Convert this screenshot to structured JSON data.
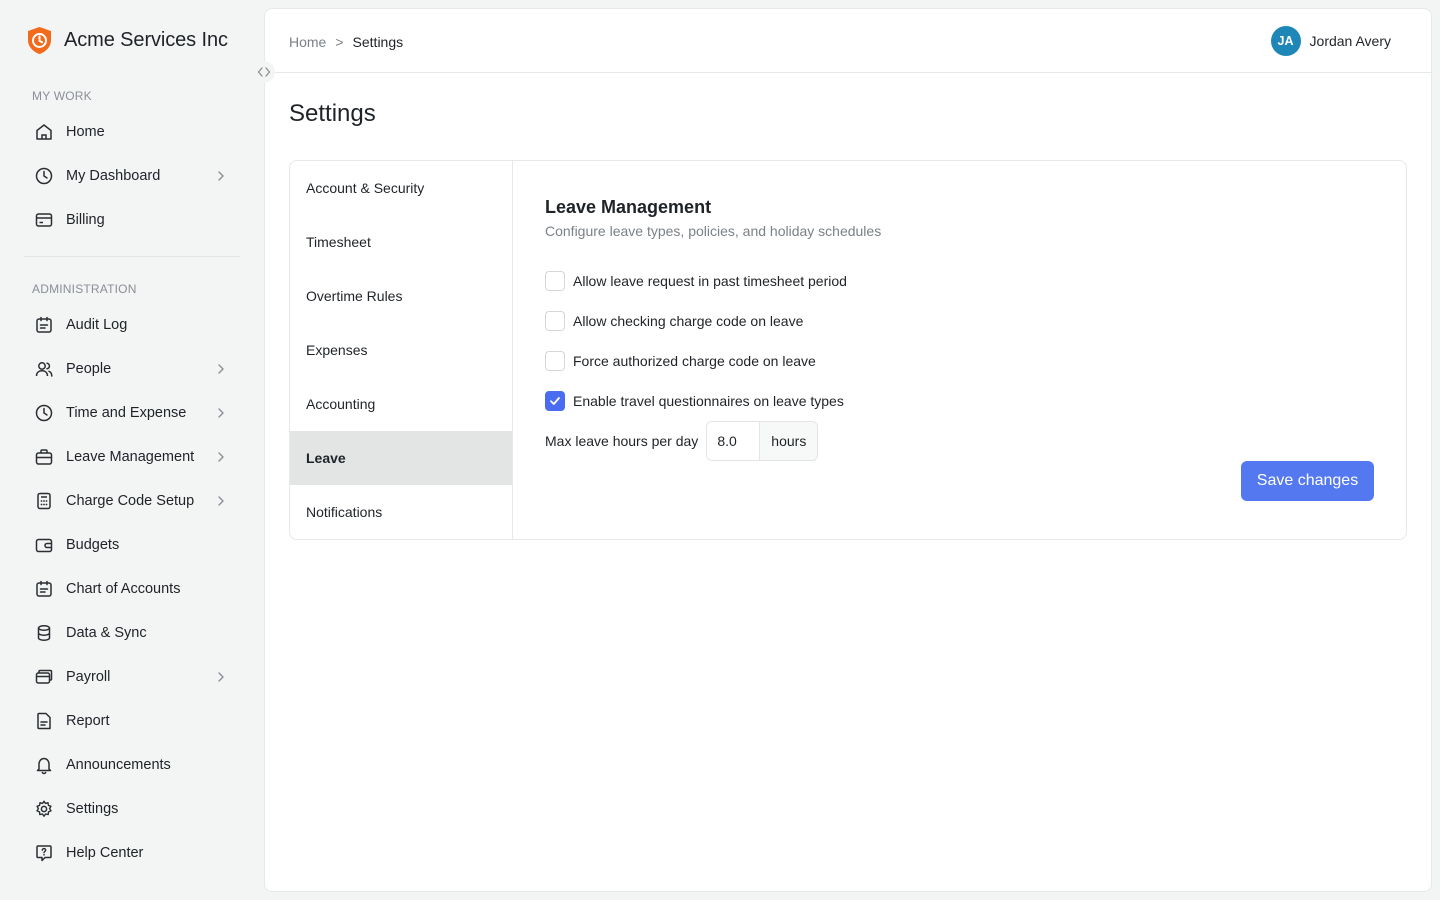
{
  "brand": {
    "name": "Acme Services Inc",
    "logo_icon": "shield-clock-icon",
    "logo_color": "#f26a1b"
  },
  "sidebar": {
    "sections": [
      {
        "label": "MY WORK"
      },
      {
        "label": "ADMINISTRATION"
      }
    ],
    "items": [
      {
        "label": "Home",
        "icon": "home-icon",
        "has_submenu": false
      },
      {
        "label": "My Dashboard",
        "icon": "clock-icon",
        "has_submenu": true
      },
      {
        "label": "Billing",
        "icon": "billing-icon",
        "has_submenu": false
      },
      {
        "label": "Audit Log",
        "icon": "calendar-icon",
        "has_submenu": false
      },
      {
        "label": "People",
        "icon": "users-icon",
        "has_submenu": true
      },
      {
        "label": "Time and Expense",
        "icon": "clock-icon",
        "has_submenu": true
      },
      {
        "label": "Leave Management",
        "icon": "briefcase-icon",
        "has_submenu": true
      },
      {
        "label": "Charge Code Setup",
        "icon": "calculator-icon",
        "has_submenu": true
      },
      {
        "label": "Budgets",
        "icon": "wallet-icon",
        "has_submenu": false
      },
      {
        "label": "Chart of Accounts",
        "icon": "calendar-icon",
        "has_submenu": false
      },
      {
        "label": "Data & Sync",
        "icon": "database-icon",
        "has_submenu": false
      },
      {
        "label": "Payroll",
        "icon": "payroll-icon",
        "has_submenu": true
      },
      {
        "label": "Report",
        "icon": "report-icon",
        "has_submenu": false
      },
      {
        "label": "Announcements",
        "icon": "bell-icon",
        "has_submenu": false
      },
      {
        "label": "Settings",
        "icon": "gear-icon",
        "has_submenu": false
      },
      {
        "label": "Help Center",
        "icon": "help-icon",
        "has_submenu": false
      }
    ]
  },
  "header": {
    "breadcrumb": {
      "home": "Home",
      "separator": ">",
      "current": "Settings"
    },
    "user": {
      "initials": "JA",
      "name": "Jordan Avery",
      "avatar_color": "#1e87b8"
    }
  },
  "page": {
    "title": "Settings"
  },
  "settings_tabs": [
    {
      "label": "Account & Security",
      "active": false
    },
    {
      "label": "Timesheet",
      "active": false
    },
    {
      "label": "Overtime Rules",
      "active": false
    },
    {
      "label": "Expenses",
      "active": false
    },
    {
      "label": "Accounting",
      "active": false
    },
    {
      "label": "Leave",
      "active": true
    },
    {
      "label": "Notifications",
      "active": false
    }
  ],
  "panel": {
    "title": "Leave Management",
    "subtitle": "Configure leave types, policies, and holiday schedules",
    "options": [
      {
        "label": "Allow leave request in past timesheet period",
        "checked": false
      },
      {
        "label": "Allow checking charge code on leave",
        "checked": false
      },
      {
        "label": "Force authorized charge code on leave",
        "checked": false
      },
      {
        "label": "Enable travel questionnaires on leave types",
        "checked": true
      }
    ],
    "max_hours": {
      "label": "Max leave hours per day",
      "value": "8.0",
      "unit": "hours"
    },
    "save_label": "Save changes",
    "accent": "#5478ef"
  }
}
